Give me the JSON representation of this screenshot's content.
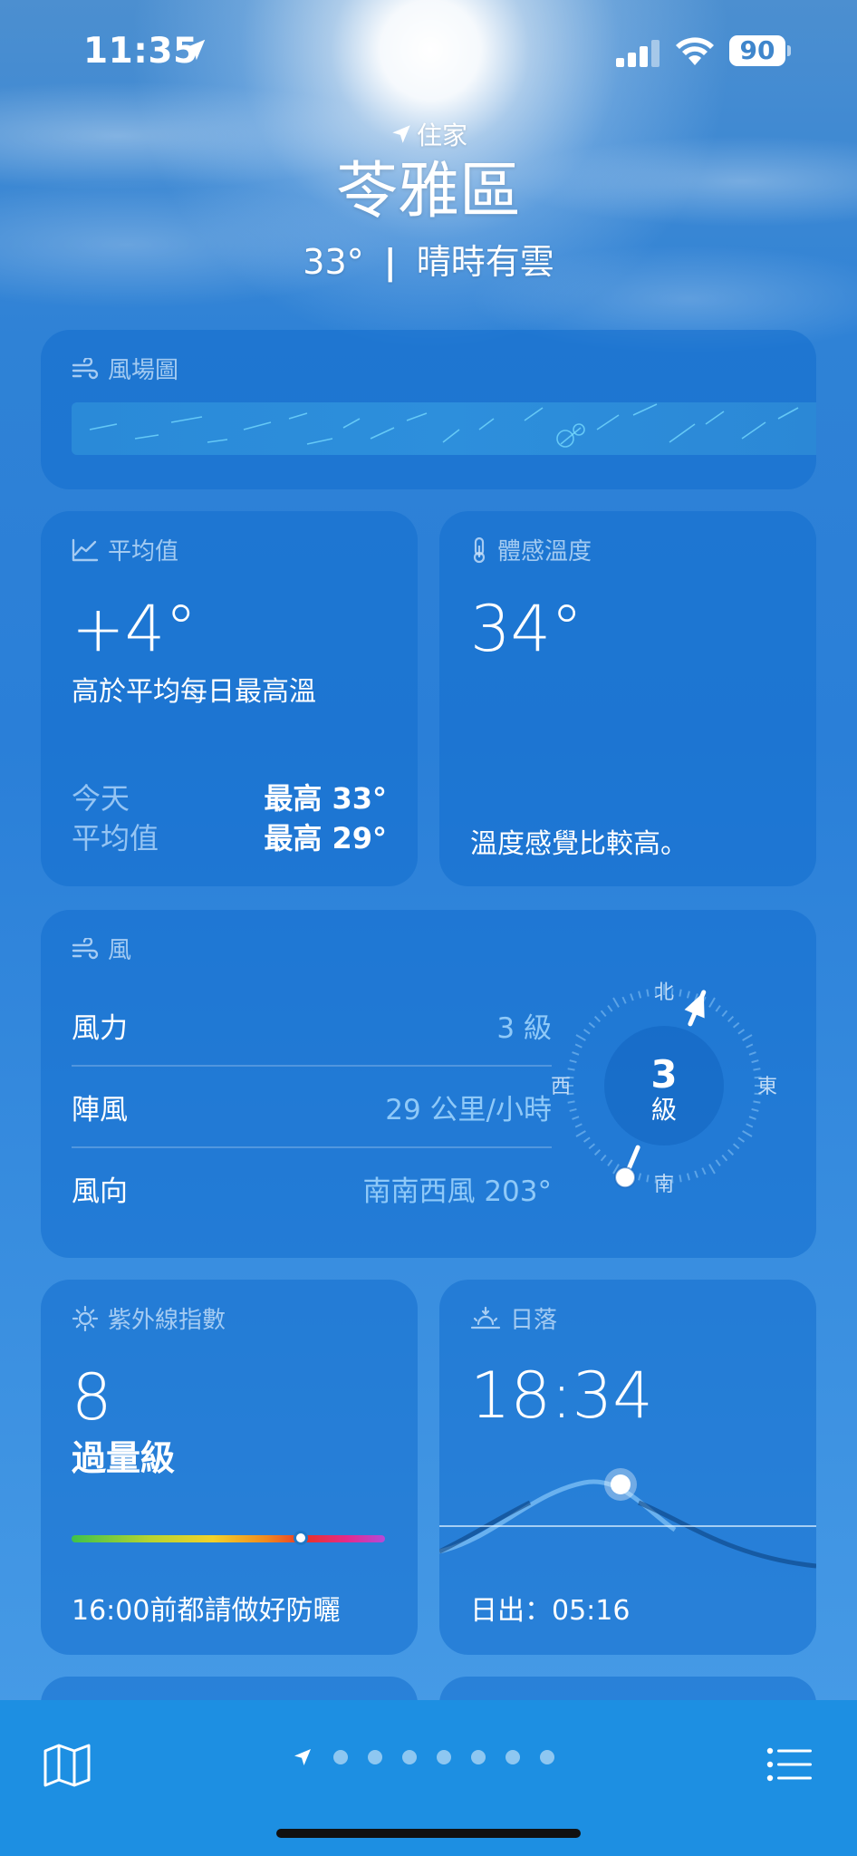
{
  "status_bar": {
    "time": "11:35",
    "battery": "90"
  },
  "header": {
    "location_label": "住家",
    "city": "苓雅區",
    "temperature": "33°",
    "separator": "|",
    "condition": "晴時有雲"
  },
  "wind_map": {
    "title": "風場圖"
  },
  "averages": {
    "title": "平均值",
    "value": "+4°",
    "description": "高於平均每日最高溫",
    "today_label": "今天",
    "today_value": "最高 33°",
    "avg_label": "平均值",
    "avg_value": "最高 29°"
  },
  "feels_like": {
    "title": "體感溫度",
    "value": "34°",
    "description": "溫度感覺比較高。"
  },
  "wind": {
    "title": "風",
    "rows": [
      {
        "label": "風力",
        "value": "3 級"
      },
      {
        "label": "陣風",
        "value": "29 公里/小時"
      },
      {
        "label": "風向",
        "value": "南南西風 203°"
      }
    ],
    "compass": {
      "north": "北",
      "south": "南",
      "east": "東",
      "west": "西",
      "center_value": "3",
      "center_unit": "級",
      "direction_degrees": 203
    }
  },
  "uv": {
    "title": "紫外線指數",
    "value": "8",
    "level": "過量級",
    "note": "16:00前都請做好防曬",
    "scale_position": 0.73
  },
  "sunset": {
    "title": "日落",
    "time": "18:34",
    "sunrise": "日出：05:16"
  },
  "colors": {
    "card_bg": "#126ecd",
    "label_blue": "#aad2f8",
    "bottom_bar": "#1d8fe2"
  },
  "bottom_bar": {
    "map_icon": "map-icon",
    "list_icon": "list-icon",
    "page_count": 7
  }
}
